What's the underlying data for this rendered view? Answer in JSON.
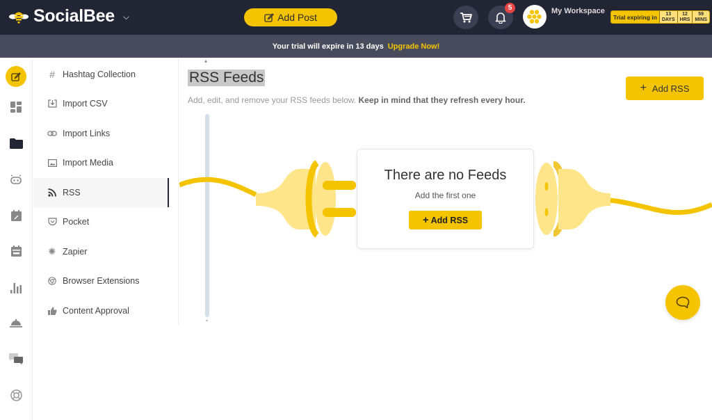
{
  "header": {
    "brand": "SocialBee",
    "add_post_label": "Add Post",
    "notification_count": "5",
    "workspace_name": "My Workspace",
    "trial": {
      "label": "Trial expiring in",
      "days_value": "13",
      "days_unit": "DAYS",
      "hrs_value": "12",
      "hrs_unit": "HRS",
      "mins_value": "59",
      "mins_unit": "MINS"
    }
  },
  "trial_banner": {
    "message": "Your trial will expire in 13 days",
    "link": "Upgrade Now!"
  },
  "rail": {
    "icons": [
      "create-post-icon",
      "dashboard-icon",
      "content-folder-icon",
      "bot-icon",
      "scheduler-icon",
      "calendar-icon",
      "analytics-icon",
      "concierge-icon",
      "engage-icon",
      "help-icon"
    ]
  },
  "submenu": {
    "items": [
      {
        "label": "Hashtag Collection",
        "icon": "hashtag-icon"
      },
      {
        "label": "Import CSV",
        "icon": "import-csv-icon"
      },
      {
        "label": "Import Links",
        "icon": "link-icon"
      },
      {
        "label": "Import Media",
        "icon": "image-icon"
      },
      {
        "label": "RSS",
        "icon": "rss-icon",
        "active": true
      },
      {
        "label": "Pocket",
        "icon": "pocket-icon"
      },
      {
        "label": "Zapier",
        "icon": "zapier-icon"
      },
      {
        "label": "Browser Extensions",
        "icon": "chrome-icon"
      },
      {
        "label": "Content Approval",
        "icon": "thumbs-up-icon"
      }
    ]
  },
  "main": {
    "title": "RSS Feeds",
    "subtitle": "Add, edit, and remove your RSS feeds below.",
    "subtitle_bold": "Keep in mind that they refresh every hour.",
    "add_rss_label": "Add RSS",
    "empty_state": {
      "title": "There are no Feeds",
      "subtitle": "Add the first one",
      "button_label": "Add RSS"
    }
  },
  "colors": {
    "brand_yellow": "#f5c400",
    "topbar": "#222534",
    "banner": "#474b5c",
    "badge": "#e84545"
  }
}
